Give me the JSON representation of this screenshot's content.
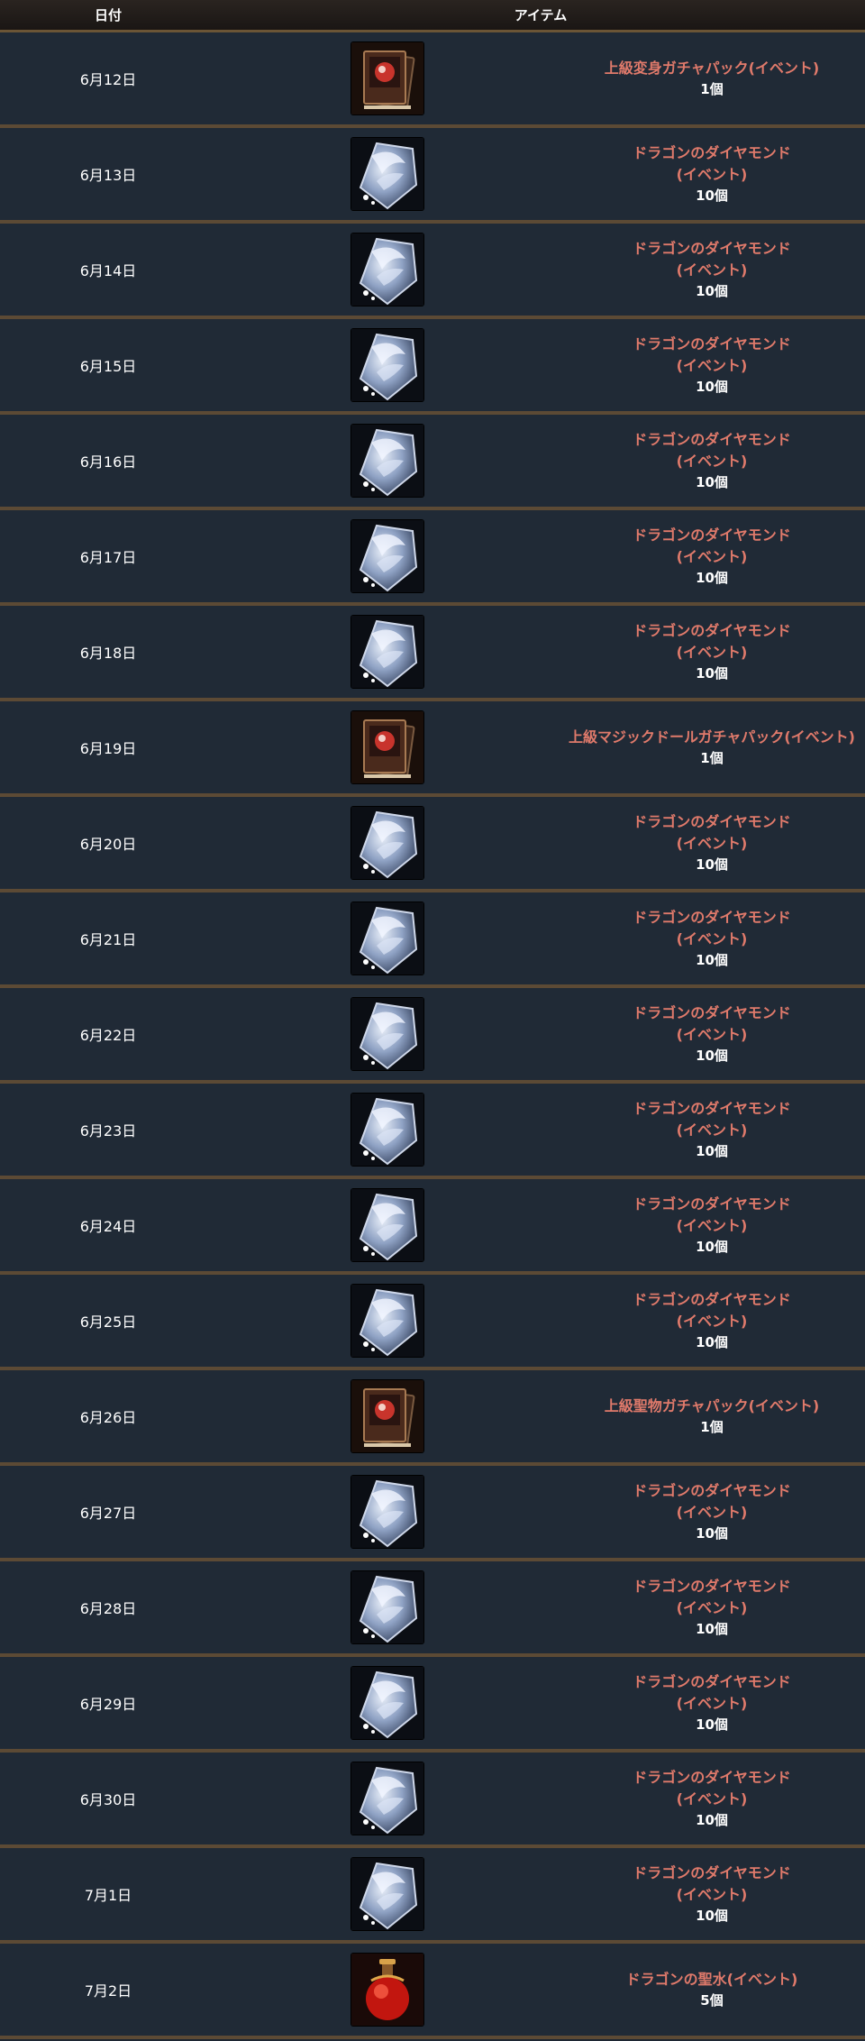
{
  "header": {
    "date_label": "日付",
    "item_label": "アイテム"
  },
  "rows": [
    {
      "date": "6月12日",
      "icon": "gacha-pack-icon",
      "name": "上級変身ガチャパック(イベント)",
      "qty": "1個"
    },
    {
      "date": "6月13日",
      "icon": "diamond-icon",
      "name": "ドラゴンのダイヤモンド\n(イベント)",
      "qty": "10個"
    },
    {
      "date": "6月14日",
      "icon": "diamond-icon",
      "name": "ドラゴンのダイヤモンド\n(イベント)",
      "qty": "10個"
    },
    {
      "date": "6月15日",
      "icon": "diamond-icon",
      "name": "ドラゴンのダイヤモンド\n(イベント)",
      "qty": "10個"
    },
    {
      "date": "6月16日",
      "icon": "diamond-icon",
      "name": "ドラゴンのダイヤモンド\n(イベント)",
      "qty": "10個"
    },
    {
      "date": "6月17日",
      "icon": "diamond-icon",
      "name": "ドラゴンのダイヤモンド\n(イベント)",
      "qty": "10個"
    },
    {
      "date": "6月18日",
      "icon": "diamond-icon",
      "name": "ドラゴンのダイヤモンド\n(イベント)",
      "qty": "10個"
    },
    {
      "date": "6月19日",
      "icon": "gacha-pack-icon",
      "name": "上級マジックドールガチャパック(イベント)",
      "qty": "1個"
    },
    {
      "date": "6月20日",
      "icon": "diamond-icon",
      "name": "ドラゴンのダイヤモンド\n(イベント)",
      "qty": "10個"
    },
    {
      "date": "6月21日",
      "icon": "diamond-icon",
      "name": "ドラゴンのダイヤモンド\n(イベント)",
      "qty": "10個"
    },
    {
      "date": "6月22日",
      "icon": "diamond-icon",
      "name": "ドラゴンのダイヤモンド\n(イベント)",
      "qty": "10個"
    },
    {
      "date": "6月23日",
      "icon": "diamond-icon",
      "name": "ドラゴンのダイヤモンド\n(イベント)",
      "qty": "10個"
    },
    {
      "date": "6月24日",
      "icon": "diamond-icon",
      "name": "ドラゴンのダイヤモンド\n(イベント)",
      "qty": "10個"
    },
    {
      "date": "6月25日",
      "icon": "diamond-icon",
      "name": "ドラゴンのダイヤモンド\n(イベント)",
      "qty": "10個"
    },
    {
      "date": "6月26日",
      "icon": "gacha-pack-icon",
      "name": "上級聖物ガチャパック(イベント)",
      "qty": "1個"
    },
    {
      "date": "6月27日",
      "icon": "diamond-icon",
      "name": "ドラゴンのダイヤモンド\n(イベント)",
      "qty": "10個"
    },
    {
      "date": "6月28日",
      "icon": "diamond-icon",
      "name": "ドラゴンのダイヤモンド\n(イベント)",
      "qty": "10個"
    },
    {
      "date": "6月29日",
      "icon": "diamond-icon",
      "name": "ドラゴンのダイヤモンド\n(イベント)",
      "qty": "10個"
    },
    {
      "date": "6月30日",
      "icon": "diamond-icon",
      "name": "ドラゴンのダイヤモンド\n(イベント)",
      "qty": "10個"
    },
    {
      "date": "7月1日",
      "icon": "diamond-icon",
      "name": "ドラゴンのダイヤモンド\n(イベント)",
      "qty": "10個"
    },
    {
      "date": "7月2日",
      "icon": "potion-icon",
      "name": "ドラゴンの聖水(イベント)",
      "qty": "5個"
    }
  ],
  "colors": {
    "item_name": "#e07a6b",
    "row_bg": "#202a36",
    "divider": "#5c4a35"
  }
}
